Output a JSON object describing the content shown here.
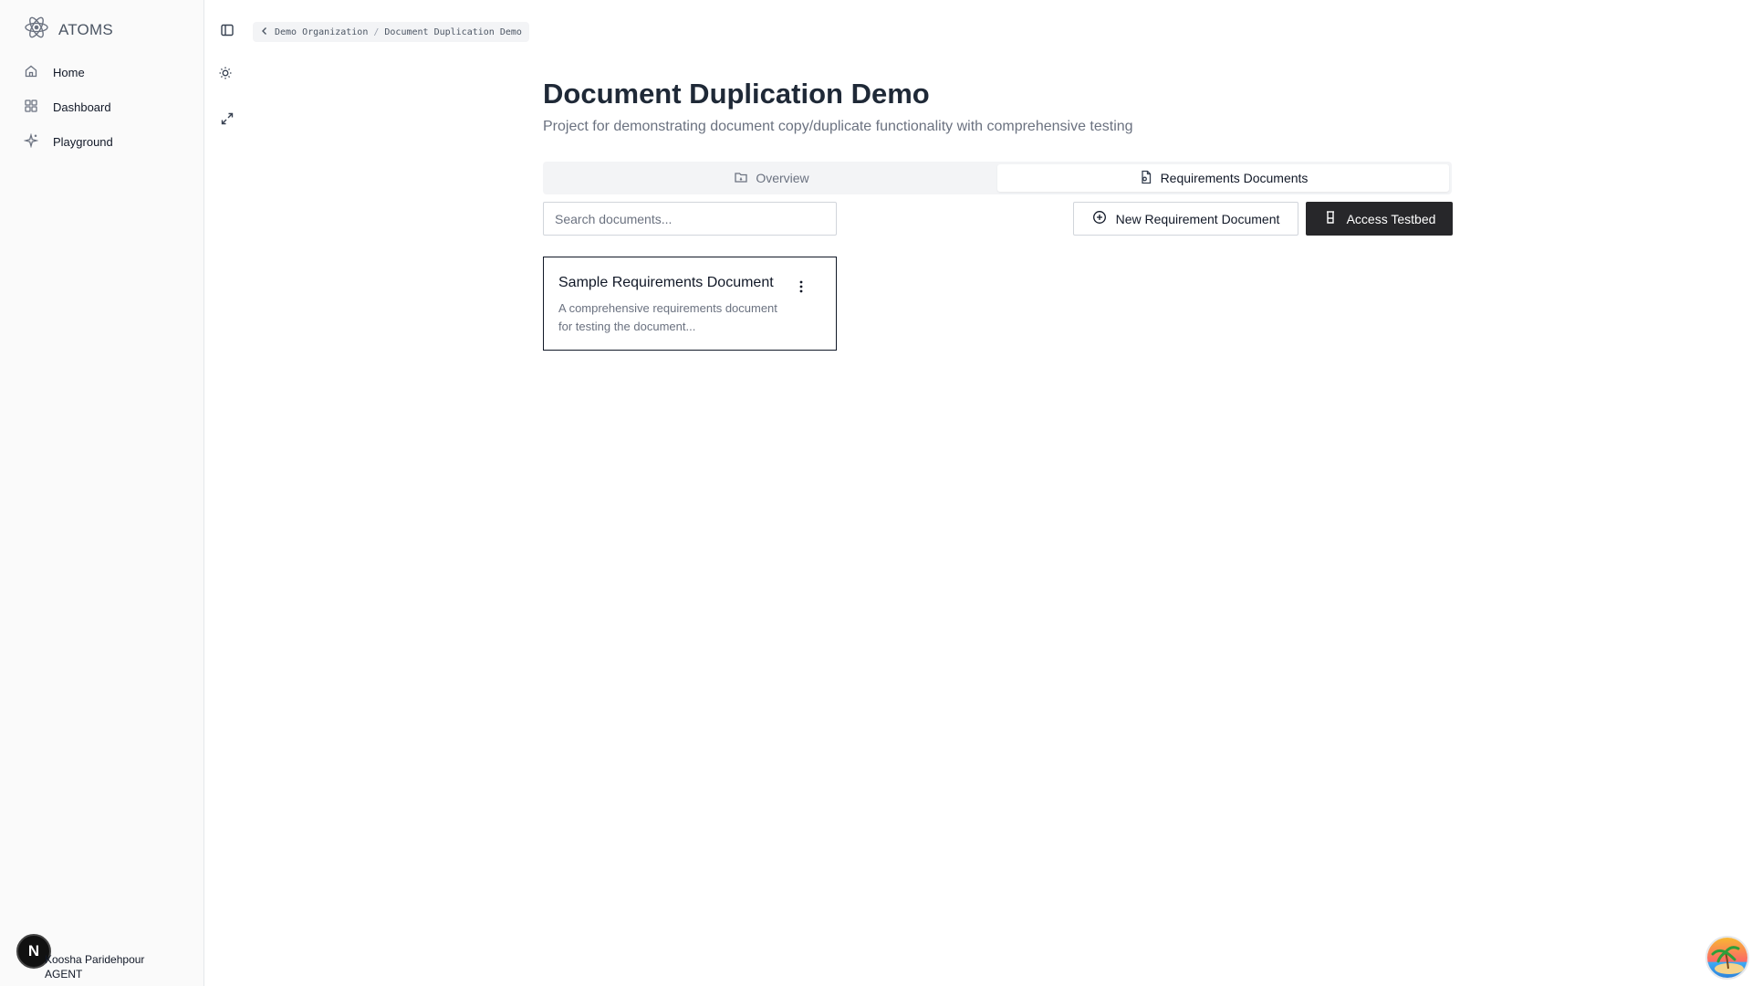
{
  "app": {
    "name": "ATOMS"
  },
  "sidebar": {
    "items": [
      {
        "label": "Home",
        "icon": "home-icon"
      },
      {
        "label": "Dashboard",
        "icon": "dashboard-icon"
      },
      {
        "label": "Playground",
        "icon": "sparkle-icon"
      }
    ],
    "user": {
      "initial": "N",
      "name": "Koosha Paridehpour",
      "role": "AGENT"
    }
  },
  "breadcrumb": {
    "organization": "Demo Organization",
    "separator": "/",
    "project": "Document Duplication Demo"
  },
  "page": {
    "title": "Document Duplication Demo",
    "subtitle": "Project for demonstrating document copy/duplicate functionality with comprehensive testing"
  },
  "tabs": [
    {
      "label": "Overview",
      "icon": "folder-icon",
      "active": false
    },
    {
      "label": "Requirements Documents",
      "icon": "document-settings-icon",
      "active": true
    }
  ],
  "search": {
    "placeholder": "Search documents...",
    "value": ""
  },
  "actions": {
    "new_document_label": "New Requirement Document",
    "testbed_label": "Access Testbed"
  },
  "documents": [
    {
      "title": "Sample Requirements Document",
      "description": "A comprehensive requirements document for testing the document..."
    }
  ],
  "colors": {
    "primary_button": "#27272a",
    "sidebar_bg": "#fafafa",
    "muted_text": "#6b7280"
  }
}
